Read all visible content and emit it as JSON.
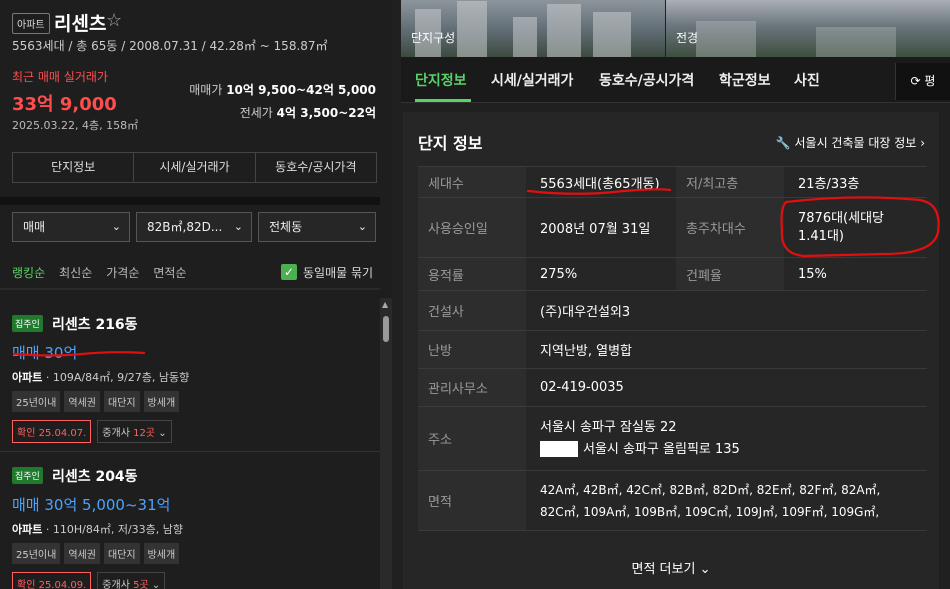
{
  "complex": {
    "type_badge": "아파트",
    "name": "리센츠",
    "star": "☆",
    "summary": "5563세대 / 총 65동 / 2008.07.31 / 42.28㎡ ~ 158.87㎡"
  },
  "recent_trade": {
    "label": "최근 매매 실거래가",
    "price": "33억 9,000",
    "meta": "2025.03.22, 4층, 158㎡"
  },
  "price_ranges": {
    "sale_label": "매매가",
    "sale_value": "10억 9,500~42억 5,000",
    "lease_label": "전세가",
    "lease_value": "4억 3,500~22억"
  },
  "left_tabs": [
    "단지정보",
    "시세/실거래가",
    "동호수/공시가격"
  ],
  "filters": {
    "trade": "매매",
    "area": "82B㎡,82D...",
    "dong": "전체동"
  },
  "sorts": {
    "items": [
      "랭킹순",
      "최신순",
      "가격순",
      "면적순"
    ],
    "same_listing_label": "동일매물 묶기"
  },
  "listings": [
    {
      "badge": "집주인",
      "name": "리센츠 216동",
      "price": "매매 30억",
      "kind": "아파트",
      "detail": "109A/84㎡, 9/27층, 남동향",
      "tags": [
        "25년이내",
        "역세권",
        "대단지",
        "방세개"
      ],
      "confirm": "확인 25.04.07.",
      "agent_prefix": "중개사 ",
      "agent_count": "12곳"
    },
    {
      "badge": "집주인",
      "name": "리센츠 204동",
      "price": "매매 30억 5,000~31억",
      "kind": "아파트",
      "detail": "110H/84㎡, 저/33층, 남향",
      "tags": [
        "25년이내",
        "역세권",
        "대단지",
        "방세개"
      ],
      "confirm": "확인 25.04.09.",
      "agent_prefix": "중개사 ",
      "agent_count": "5곳"
    }
  ],
  "photos": {
    "captions": [
      "단지구성",
      "전경"
    ]
  },
  "right_tabs": [
    "단지정보",
    "시세/실거래가",
    "동호수/공시가격",
    "학군정보",
    "사진"
  ],
  "refresh_label": "평",
  "card": {
    "title": "단지 정보",
    "link": "서울시 건축물 대장 정보",
    "rows": [
      {
        "l1": "세대수",
        "v1": "5563세대(총65개동)",
        "l2": "저/최고층",
        "v2": "21층/33층"
      },
      {
        "l1": "사용승인일",
        "v1": "2008년 07월 31일",
        "l2": "총주차대수",
        "v2": "7876대(세대당 1.41대)"
      },
      {
        "l1": "용적률",
        "v1": "275%",
        "l2": "건폐율",
        "v2": "15%"
      }
    ],
    "builder_label": "건설사",
    "builder": "(주)대우건설외3",
    "heating_label": "난방",
    "heating": "지역난방, 열병합",
    "office_label": "관리사무소",
    "office": "02-419-0035",
    "address_label": "주소",
    "address_lot": "서울시 송파구 잠실동 22",
    "address_road": "서울시 송파구 올림픽로 135",
    "area_label": "면적",
    "areas_line1": "42A㎡, 42B㎡, 42C㎡, 82B㎡, 82D㎡, 82E㎡, 82F㎡, 82A㎡,",
    "areas_line2": "82C㎡, 109A㎡, 109B㎡, 109C㎡, 109J㎡, 109F㎡, 109G㎡,",
    "more": "면적 더보기"
  },
  "colors": {
    "accent_green": "#5ad26a",
    "price_red": "#ff4d4d",
    "listing_blue": "#4aa3ff",
    "annotation_red": "#e01010"
  }
}
